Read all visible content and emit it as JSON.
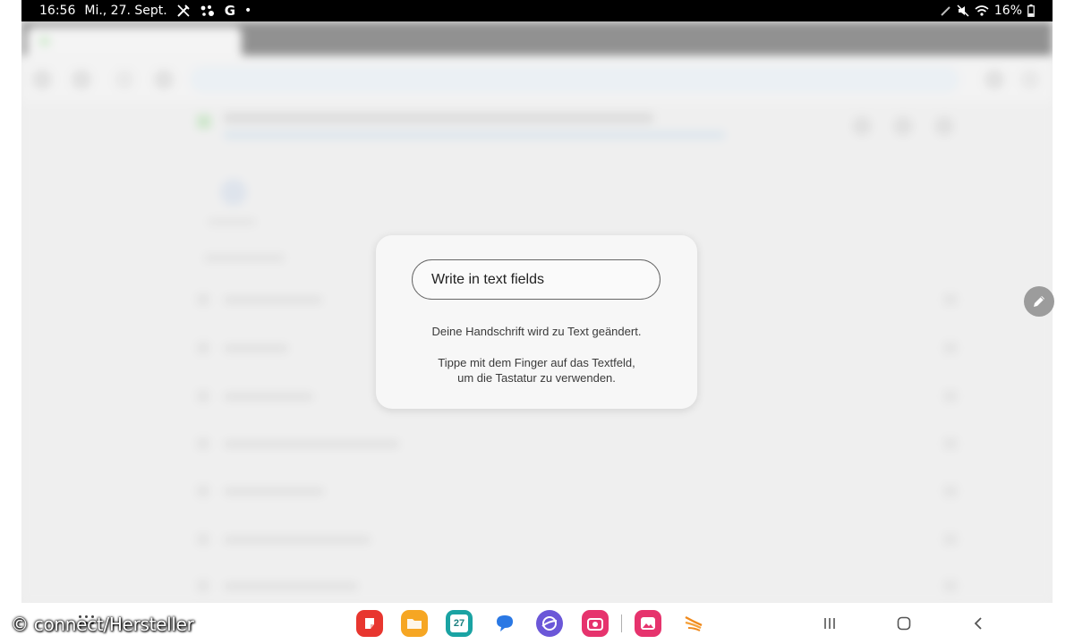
{
  "status_bar": {
    "time": "16:56",
    "date": "Mi., 27. Sept.",
    "google_label": "G",
    "dot": "•",
    "battery": "16%",
    "icons": [
      "no-pen-icon",
      "assistant-icon",
      "google-icon",
      "pen-icon",
      "mute-icon",
      "wifi-icon",
      "battery-icon"
    ]
  },
  "dialog": {
    "field_text": "Write in text fields",
    "line1": "Deine Handschrift wird zu Text geändert.",
    "line2a": "Tippe mit dem Finger auf das Textfeld,",
    "line2b": "um die Tastatur zu verwenden."
  },
  "taskbar": {
    "apps": [
      {
        "name": "notes-app-icon",
        "color": "#e8362f"
      },
      {
        "name": "files-app-icon",
        "color": "#f6a623"
      },
      {
        "name": "calendar-app-icon",
        "color": "#1aa3a3",
        "label": "27"
      },
      {
        "name": "messages-app-icon",
        "color": "#2a78e4"
      },
      {
        "name": "internet-app-icon",
        "color": "#6b57d8"
      },
      {
        "name": "camera-app-icon",
        "color": "#e6336d"
      },
      {
        "name": "gallery-app-icon",
        "color": "#e6336d"
      },
      {
        "name": "swift-app-icon",
        "color": "#f08a1c"
      }
    ],
    "nav_icons": [
      "recents-icon",
      "home-icon",
      "back-icon"
    ]
  },
  "watermark": "© connect/Hersteller",
  "colors": {
    "dialog_bg": "#f7f7f7",
    "statusbar_bg": "#000000",
    "pen_button": "#9c9c9c"
  }
}
